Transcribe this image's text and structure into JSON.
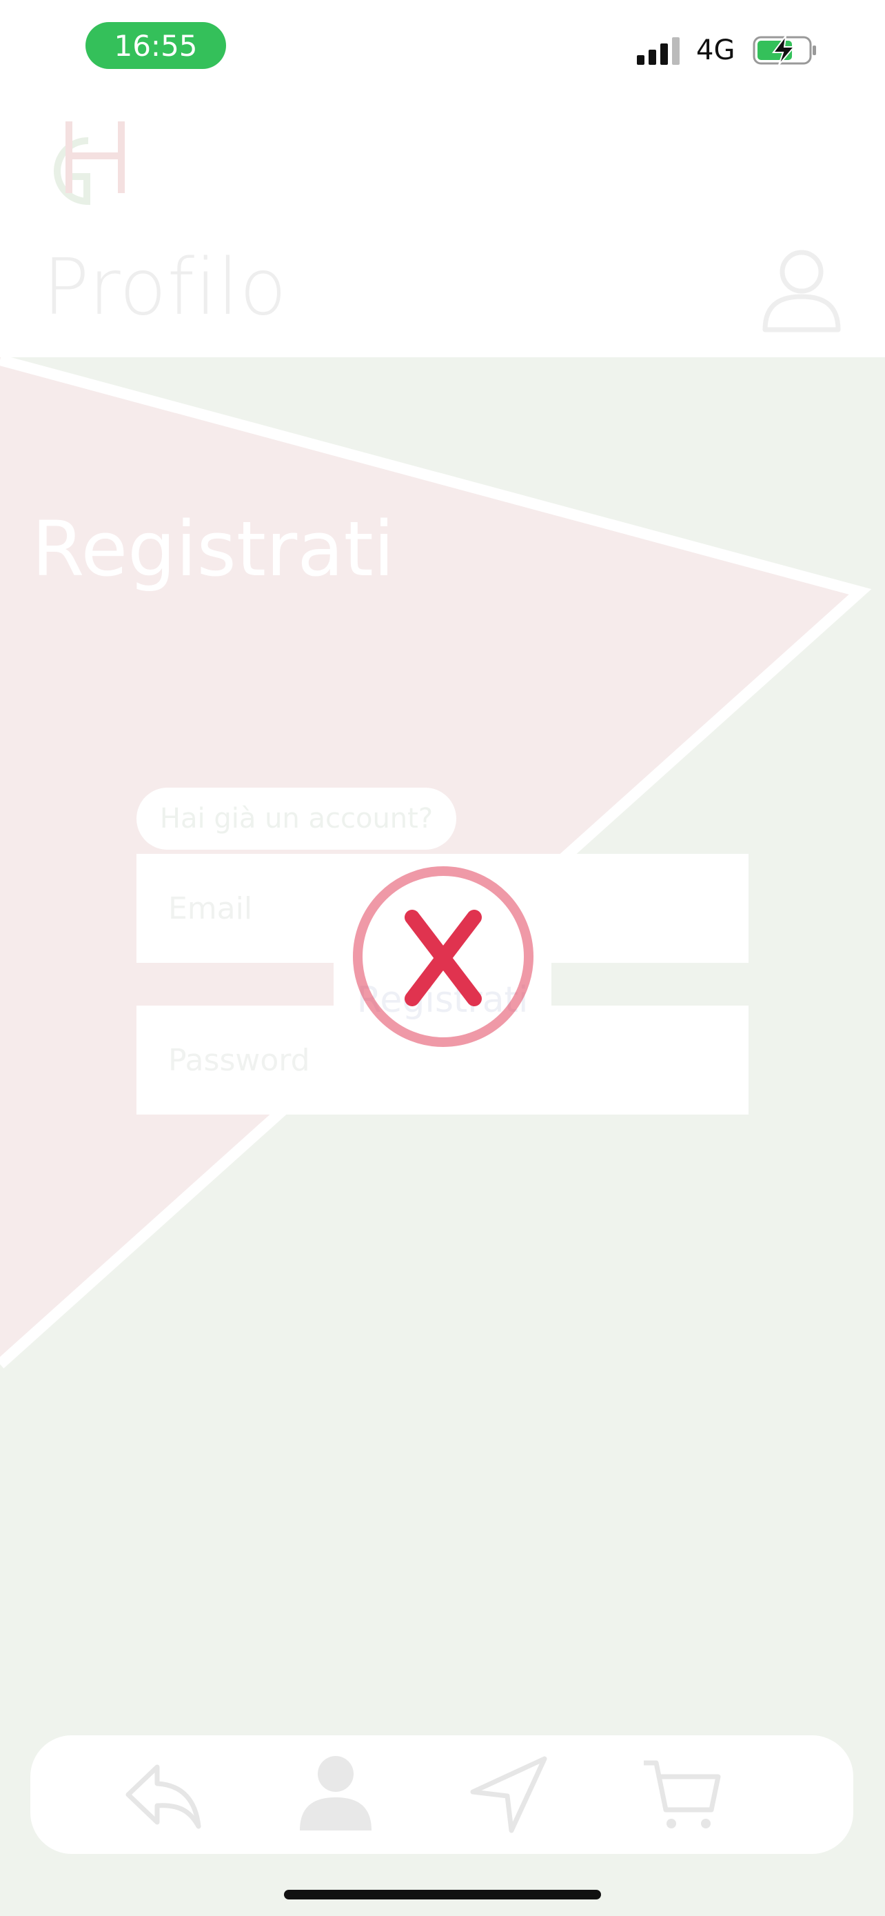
{
  "status_bar": {
    "time": "16:55",
    "network": "4G"
  },
  "header": {
    "title": "Profilo",
    "logo_icon": "gh-logo",
    "profile_icon": "user-outline-icon"
  },
  "main": {
    "heading": "Registrati",
    "email_placeholder": "Email",
    "password_placeholder": "Password",
    "login_link": "Hai già un account?",
    "submit_label": "Registrati"
  },
  "overlay": {
    "icon": "error-x-icon",
    "color": "#e0334f"
  },
  "tabbar": {
    "items": [
      {
        "icon": "reply-icon"
      },
      {
        "icon": "user-icon"
      },
      {
        "icon": "navigation-icon"
      },
      {
        "icon": "cart-icon"
      }
    ]
  },
  "colors": {
    "accent_green": "#34c05a",
    "background_green": "#eff3ed",
    "background_red": "#f6ebeb"
  }
}
